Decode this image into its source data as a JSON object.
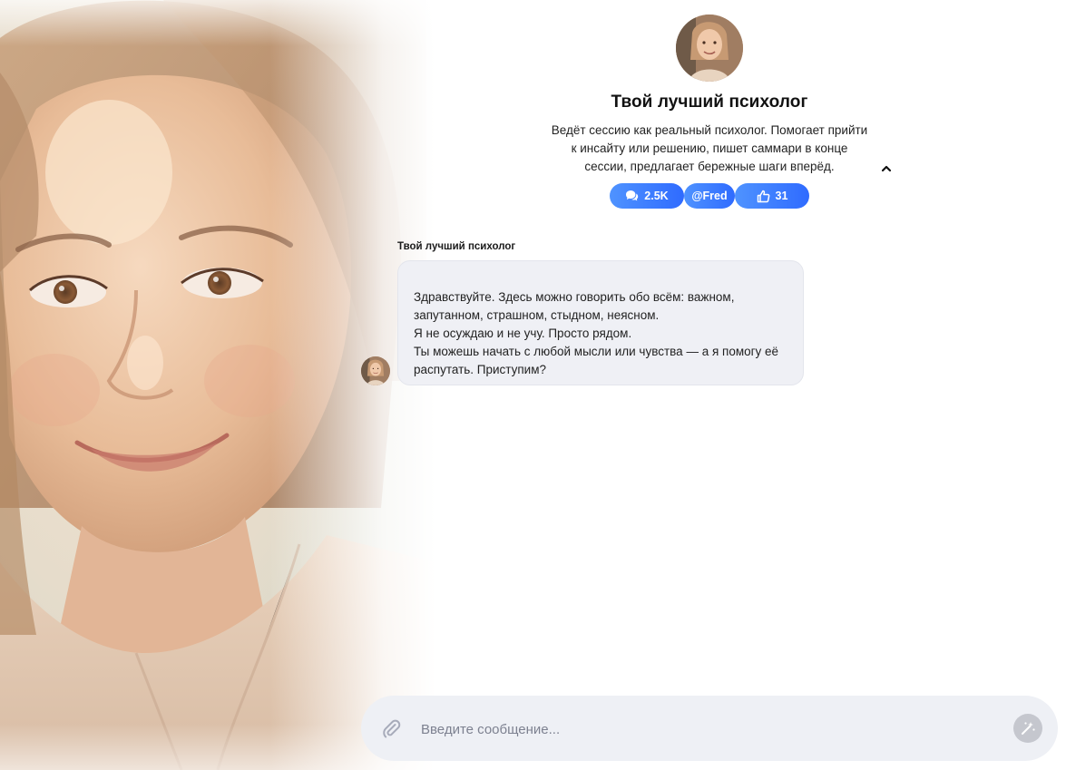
{
  "agent": {
    "name": "Твой лучший психолог",
    "description": "Ведёт сессию как реальный психолог. Помогает прийти к инсайту или решению, пишет саммари в конце сессии, предлагает бережные шаги вперёд.",
    "stats": {
      "chats": "2.5K",
      "author": "@Fred",
      "likes": "31"
    }
  },
  "message": {
    "author": "Твой лучший психолог",
    "lines": [
      "Здравствуйте. Здесь можно говорить обо всём: важном, запутанном, страшном, стыдном, неясном.",
      "Я не осуждаю и не учу. Просто рядом.",
      "Ты можешь начать с любой мысли или чувства — а я помогу её распутать. Приступим?"
    ]
  },
  "composer": {
    "placeholder": "Введите сообщение..."
  },
  "colors": {
    "accent_start": "#4f93ff",
    "accent_end": "#2f6bff",
    "bubble_bg": "#eff0f5",
    "composer_bg": "#eef0f5"
  },
  "icons": {
    "collapse": "chevron-up-icon",
    "chats": "chat-bubbles-icon",
    "likes": "thumbs-up-icon",
    "attach": "paperclip-icon",
    "magic": "magic-wand-icon"
  }
}
